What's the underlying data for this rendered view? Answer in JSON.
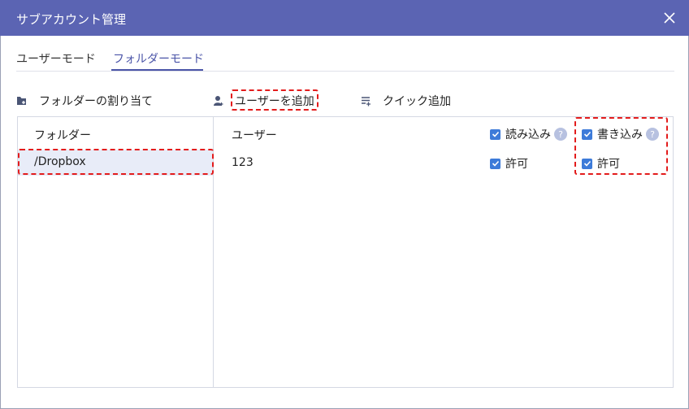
{
  "window": {
    "title": "サブアカウント管理"
  },
  "tabs": [
    {
      "label": "ユーザーモード"
    },
    {
      "label": "フォルダーモード"
    }
  ],
  "toolbar": {
    "assign_folder": "フォルダーの割り当て",
    "add_user": "ユーザーを追加",
    "quick_add": "クイック追加"
  },
  "folders": {
    "header": "フォルダー",
    "items": [
      {
        "name": "/Dropbox"
      }
    ]
  },
  "users": {
    "header": "ユーザー",
    "read_header": "読み込み",
    "write_header": "書き込み",
    "rows": [
      {
        "name": "123",
        "read": "許可",
        "write": "許可"
      }
    ]
  },
  "colors": {
    "titlebar": "#5b64b3",
    "accent": "#4b55a8",
    "checkbox": "#3d7bd9",
    "highlight": "#e31c1c"
  }
}
